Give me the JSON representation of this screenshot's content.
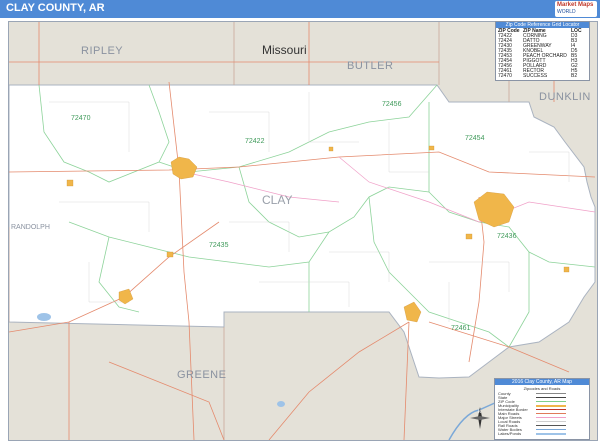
{
  "header": {
    "title": "CLAY COUNTY, AR",
    "logo_line1": "Market Maps",
    "logo_line2": "WORLD"
  },
  "map": {
    "state_label": "Missouri",
    "county_labels": {
      "ripley": "RIPLEY",
      "butler": "BUTLER",
      "dunklin": "DUNKLIN",
      "clay": "CLAY",
      "greene": "GREENE",
      "randolph": "RANDOLPH"
    },
    "zip_labels": [
      "72470",
      "72422",
      "72456",
      "72454",
      "72435",
      "72436",
      "72461"
    ],
    "colors": {
      "county_fill": "#ffffff",
      "outside_fill": "#e4e1d8",
      "zip_lines": "#7fd08a",
      "roads": "#e07a5a",
      "towns": "#f0b64a",
      "header": "#4f8ad6"
    }
  },
  "zip_table": {
    "title": "Zip Code Reference Grid Locator",
    "headers": [
      "ZIP Code",
      "ZIP Name",
      "LOC"
    ],
    "rows": [
      [
        "72422",
        "CORNING",
        "D3"
      ],
      [
        "72424",
        "DATTO",
        "B3"
      ],
      [
        "72430",
        "GREENWAY",
        "I4"
      ],
      [
        "72435",
        "KNOBEL",
        "D5"
      ],
      [
        "72453",
        "PEACH ORCHARD",
        "B5"
      ],
      [
        "72454",
        "PIGGOTT",
        "H3"
      ],
      [
        "72456",
        "POLLARD",
        "G2"
      ],
      [
        "72461",
        "RECTOR",
        "H5"
      ],
      [
        "72470",
        "SUCCESS",
        "B2"
      ]
    ]
  },
  "legend": {
    "title": "2016 Clay County, AR Map",
    "subtitle": "Zipcodes and Roads",
    "rows": [
      "County",
      "State",
      "ZIP Code",
      "Municipality",
      "Interstate Border",
      "Main Roads",
      "Major Streets",
      "Local Roads",
      "Rail Roads",
      "Water Bodies",
      "Lakes/Ponds"
    ]
  }
}
